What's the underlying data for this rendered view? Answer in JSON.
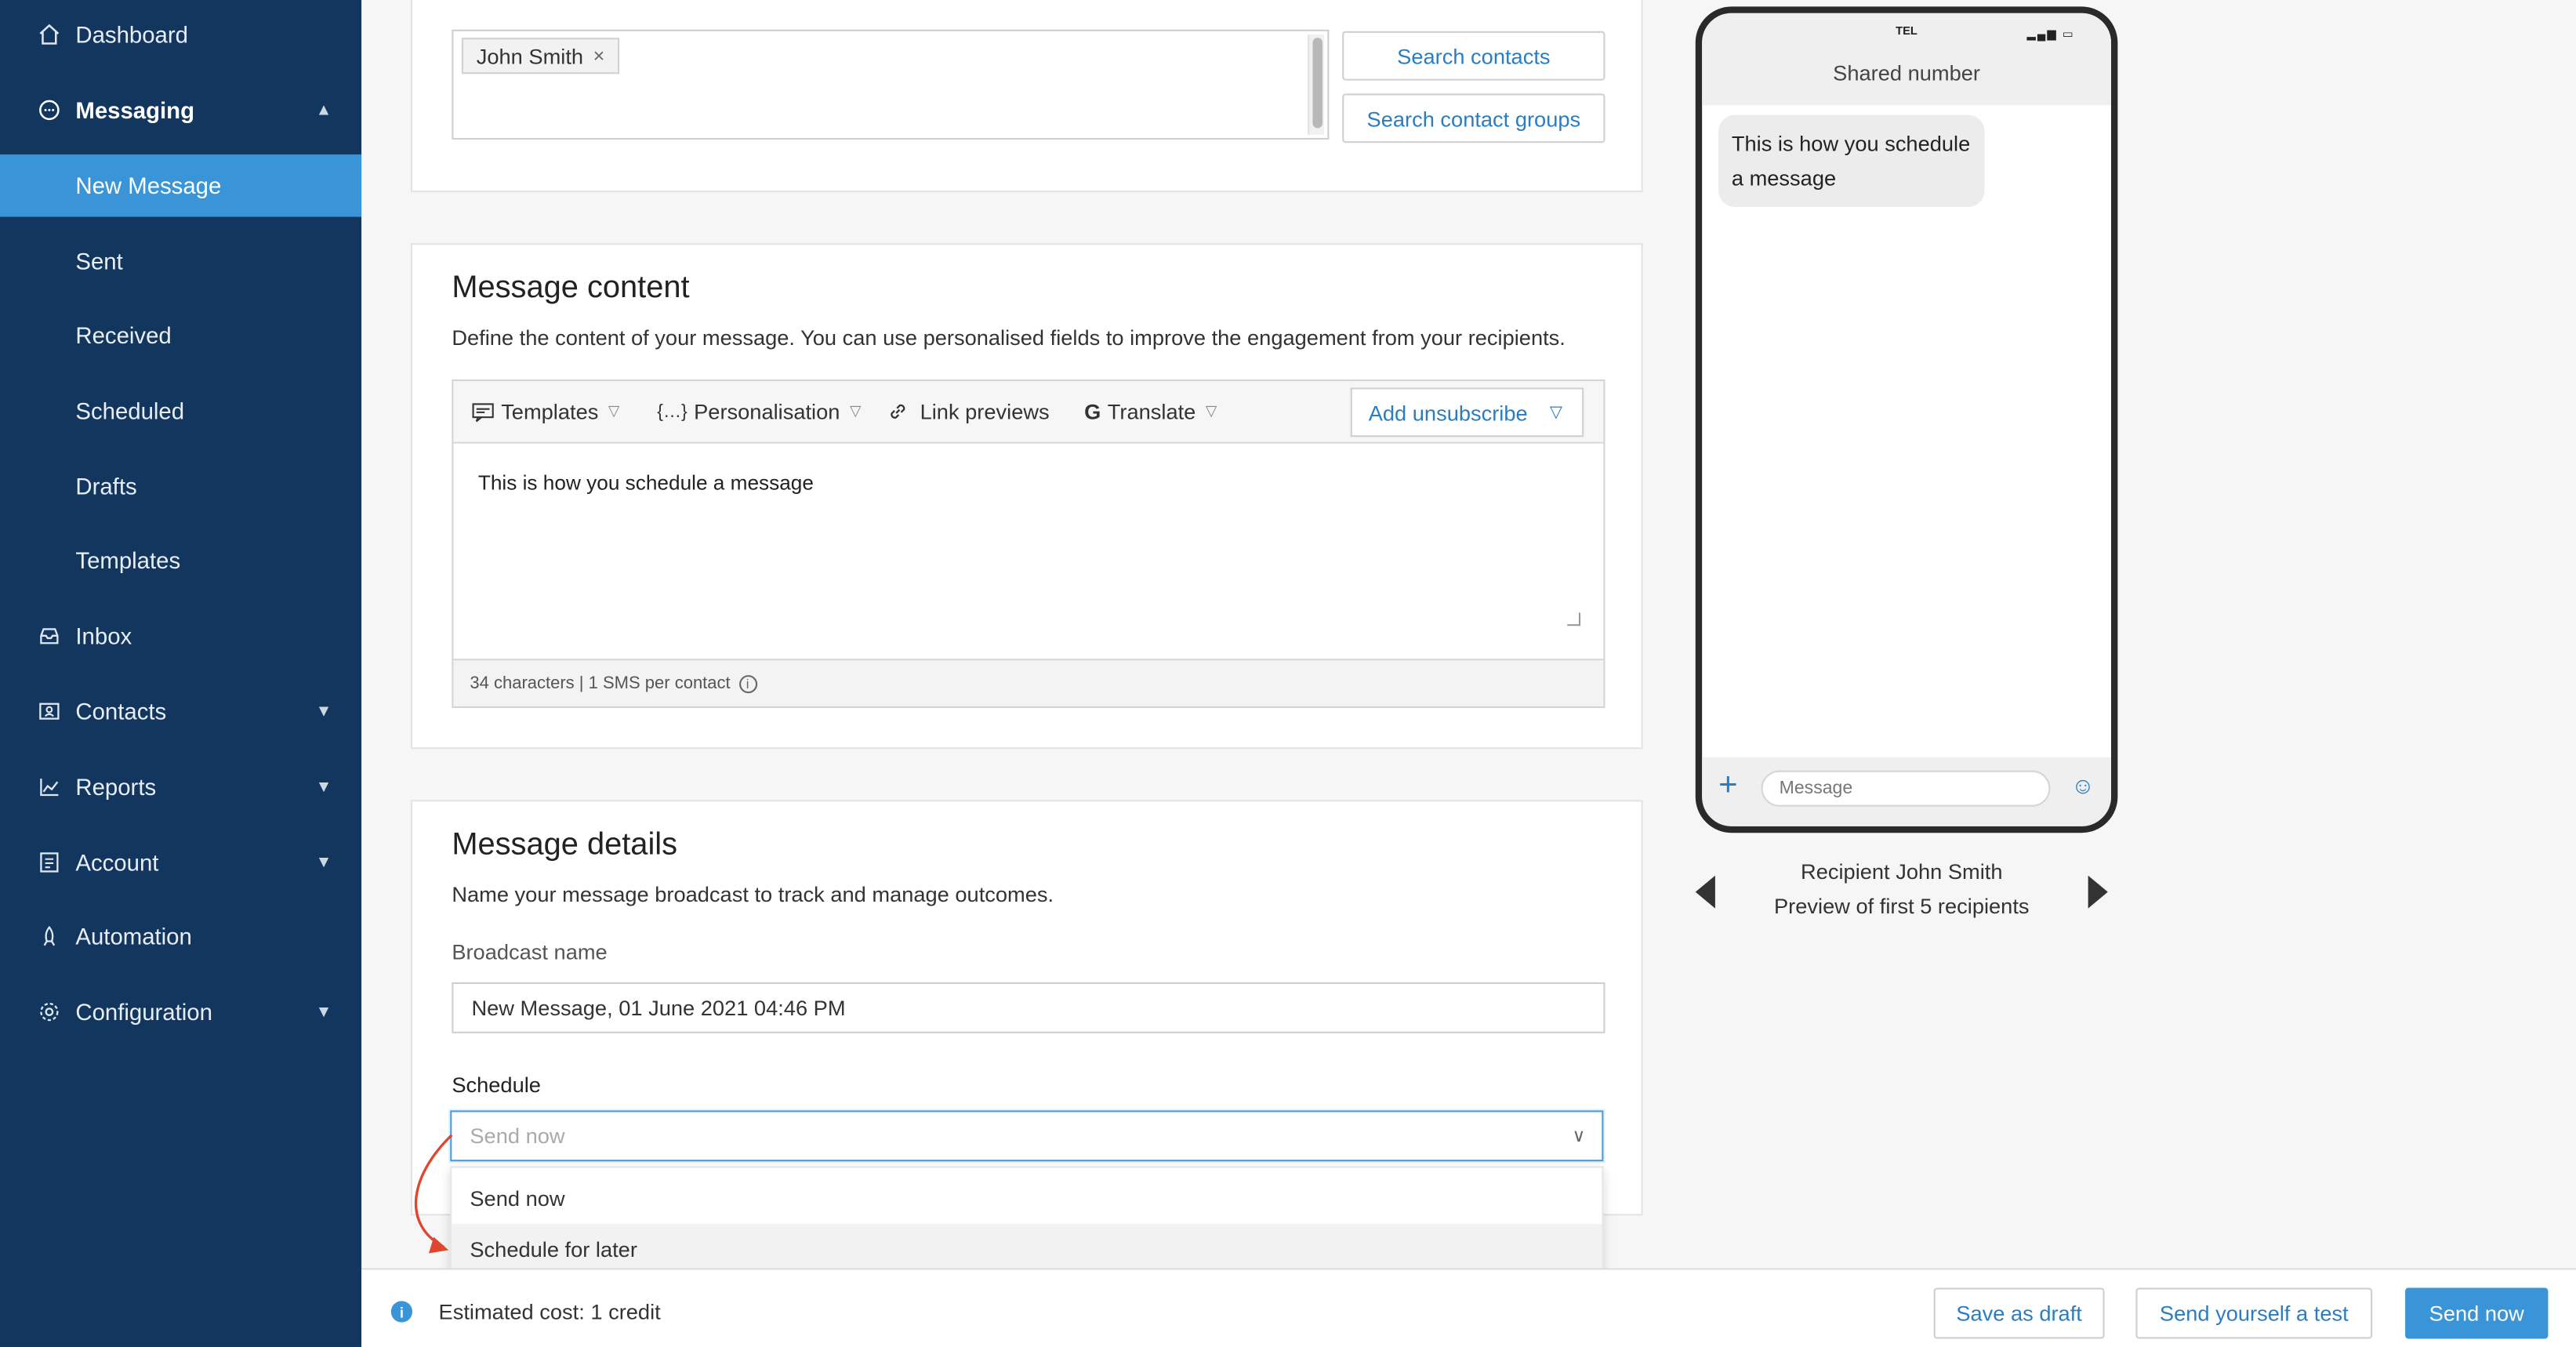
{
  "sidebar": {
    "items": [
      {
        "label": "Dashboard",
        "icon": "home-icon"
      },
      {
        "label": "Messaging",
        "icon": "chat-icon",
        "expanded": true
      },
      {
        "label": "New Message",
        "active": true
      },
      {
        "label": "Sent"
      },
      {
        "label": "Received"
      },
      {
        "label": "Scheduled"
      },
      {
        "label": "Drafts"
      },
      {
        "label": "Templates"
      },
      {
        "label": "Inbox",
        "icon": "inbox-icon"
      },
      {
        "label": "Contacts",
        "icon": "contacts-icon",
        "has_children": true
      },
      {
        "label": "Reports",
        "icon": "reports-icon",
        "has_children": true
      },
      {
        "label": "Account",
        "icon": "account-icon",
        "has_children": true
      },
      {
        "label": "Automation",
        "icon": "automation-icon"
      },
      {
        "label": "Configuration",
        "icon": "gear-icon",
        "has_children": true
      }
    ]
  },
  "recipients": {
    "chips": [
      {
        "label": "John Smith",
        "remove": "×"
      }
    ],
    "search_contacts": "Search contacts",
    "search_groups": "Search contact groups"
  },
  "message_content": {
    "title": "Message content",
    "description": "Define the content of your message. You can use personalised fields to improve the engagement from your recipients.",
    "toolbar": {
      "templates": "Templates",
      "personalisation": "Personalisation",
      "link_previews": "Link previews",
      "translate": "Translate",
      "add_unsubscribe": "Add unsubscribe"
    },
    "body": "This is how you schedule a message",
    "counter": "34 characters | 1 SMS per contact"
  },
  "message_details": {
    "title": "Message details",
    "description": "Name your message broadcast to track and manage outcomes.",
    "broadcast_label": "Broadcast name",
    "broadcast_value": "New Message, 01 June 2021 04:46 PM",
    "schedule_label": "Schedule",
    "schedule_placeholder": "Send now",
    "options": [
      "Send now",
      "Schedule for later"
    ],
    "highlighted_option": "Schedule for later"
  },
  "phone_preview": {
    "carrier": "TEL",
    "header": "Shared number",
    "bubble": "This is how you schedule a message",
    "input_placeholder": "Message",
    "recipient_line": "Recipient John Smith",
    "preview_line": "Preview of first 5 recipients"
  },
  "footer": {
    "cost": "Estimated cost: 1 credit",
    "save_draft": "Save as draft",
    "send_test": "Send yourself a test",
    "send_now": "Send now"
  },
  "colors": {
    "sidebar_bg": "#13365f",
    "active": "#3a95d8",
    "accent_text": "#2a7dc0",
    "annotation_arrow": "#e0452f"
  }
}
